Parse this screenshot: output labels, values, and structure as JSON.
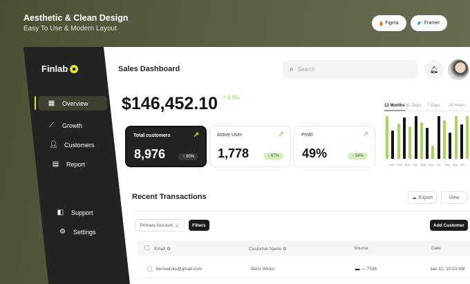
{
  "hero": {
    "title": "Aesthetic & Clean Design",
    "subtitle": "Easy To Use & Modern Layout",
    "buttons": [
      {
        "label": "Figma",
        "icon": "figma-icon"
      },
      {
        "label": "Framer",
        "icon": "framer-icon"
      }
    ]
  },
  "sidebar": {
    "logo": "Finlab",
    "items": [
      {
        "label": "Overview",
        "icon": "grid-icon"
      },
      {
        "label": "Growth",
        "icon": "chart-icon"
      },
      {
        "label": "Customers",
        "icon": "user-icon"
      },
      {
        "label": "Report",
        "icon": "report-icon"
      },
      {
        "label": "Support",
        "icon": "support-icon"
      },
      {
        "label": "Settings",
        "icon": "gear-icon"
      }
    ]
  },
  "header": {
    "title": "Sales Dashboard",
    "search_placeholder": "Search"
  },
  "summary": {
    "total": "$146,452.10",
    "trend": "8.9%"
  },
  "cards": [
    {
      "label": "Total customers",
      "value": "8,976",
      "badge": "↑ 90%"
    },
    {
      "label": "Active User",
      "value": "1,778",
      "badge": "↑ 67%"
    },
    {
      "label": "Profit",
      "value": "49%",
      "badge": "↑ 54%"
    }
  ],
  "chart_tabs": [
    "12 Months",
    "30 Days",
    "7 Days",
    "24 Hours"
  ],
  "chart_data": {
    "type": "bar",
    "categories": [
      "Jan",
      "Feb",
      "Mar",
      "Apr",
      "May",
      "Jun",
      "Jul",
      "Aug",
      "Sep",
      "Oct"
    ],
    "values": [
      100,
      66,
      83,
      97,
      76,
      100,
      86,
      72,
      30,
      100,
      90,
      62,
      100,
      81,
      100
    ],
    "colors": [
      "#a6d75b",
      "#151515"
    ]
  },
  "transactions": {
    "title": "Recent Transactions",
    "export": "Export",
    "view": "View",
    "filter_chip": "Primary Account",
    "filters": "Filters",
    "add": "Add Customer",
    "columns": [
      "Email",
      "Customer Name",
      "Source",
      "Date"
    ],
    "rows": [
      {
        "email": "benswicks@gmail.com",
        "name": "Bens Wicks",
        "source": "— 7536",
        "date": "Jan 12, 10:23 AM"
      }
    ]
  }
}
